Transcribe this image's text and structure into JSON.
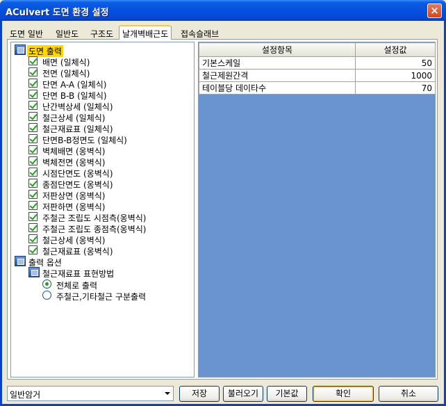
{
  "window": {
    "title": "ACulvert 도면 환경 설정",
    "close_glyph": "×"
  },
  "tabs": [
    "도면 일반",
    "일반도",
    "구조도",
    "날개벽배근도",
    "접속슬래브"
  ],
  "tree": {
    "root1": "도면 출력",
    "items": [
      "배면 (일체식)",
      "전면 (일체식)",
      "단면 A-A (일체식)",
      "단면 B-B (일체식)",
      "난간벽상세 (일체식)",
      "철근상세 (일체식)",
      "철근재료표 (일체식)",
      "단면B-B정면도 (일체식)",
      "벽체배면 (옹벽식)",
      "벽체전면 (옹벽식)",
      "시점단면도 (옹벽식)",
      "종점단면도 (옹벽식)",
      "저판상면 (옹벽식)",
      "저판하면 (옹벽식)",
      "주철근 조립도 시점측(옹벽식)",
      "주철근 조립도 종점측(옹벽식)",
      "철근상세 (옹벽식)",
      "철근재료표 (옹벽식)"
    ],
    "root2": "출력 옵션",
    "sub": "철근재료표 표현방법",
    "radios": [
      "전체로 출력",
      "주철근,기타철근 구분출력"
    ]
  },
  "grid": {
    "headers": [
      "설정항목",
      "설정값"
    ],
    "rows": [
      [
        "기본스케일",
        "50"
      ],
      [
        "철근제원간격",
        "1000"
      ],
      [
        "테이블당 데이타수",
        "70"
      ]
    ]
  },
  "bottom": {
    "combo_value": "일반암거",
    "buttons": [
      "저장",
      "불러오기",
      "기본값",
      "확인",
      "취소"
    ]
  },
  "colors": {
    "title_bar": "#0a5ee4",
    "grid_bg": "#6a94d0",
    "selection": "#ffd800"
  }
}
